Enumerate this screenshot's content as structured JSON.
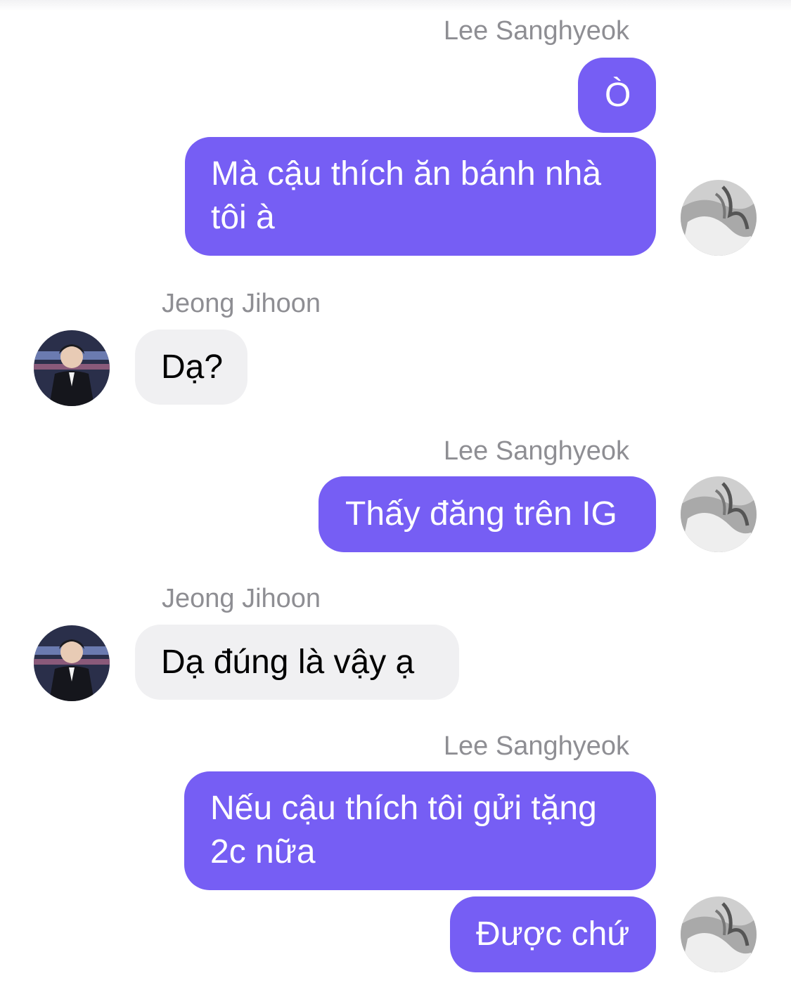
{
  "senders": {
    "me": "Lee Sanghyeok",
    "other": "Jeong Jihoon"
  },
  "messages": [
    {
      "sender": "Lee Sanghyeok",
      "text": "Ò"
    },
    {
      "sender": "Lee Sanghyeok",
      "lines": [
        "Mà cậu thích ăn bánh nhà",
        "tôi à"
      ]
    },
    {
      "sender": "Jeong Jihoon",
      "text": "Dạ?"
    },
    {
      "sender": "Lee Sanghyeok",
      "text": "Thấy đăng trên IG"
    },
    {
      "sender": "Jeong Jihoon",
      "text": "Dạ đúng là vậy ạ"
    },
    {
      "sender": "Lee Sanghyeok",
      "lines": [
        "Nếu cậu thích tôi gửi tặng",
        "2c nữa"
      ]
    },
    {
      "sender": "Lee Sanghyeok",
      "text": "Được chứ"
    }
  ],
  "colors": {
    "outgoing_bubble": "#765ef4",
    "incoming_bubble": "#f0f0f2",
    "sender_name": "#8e8e93"
  }
}
